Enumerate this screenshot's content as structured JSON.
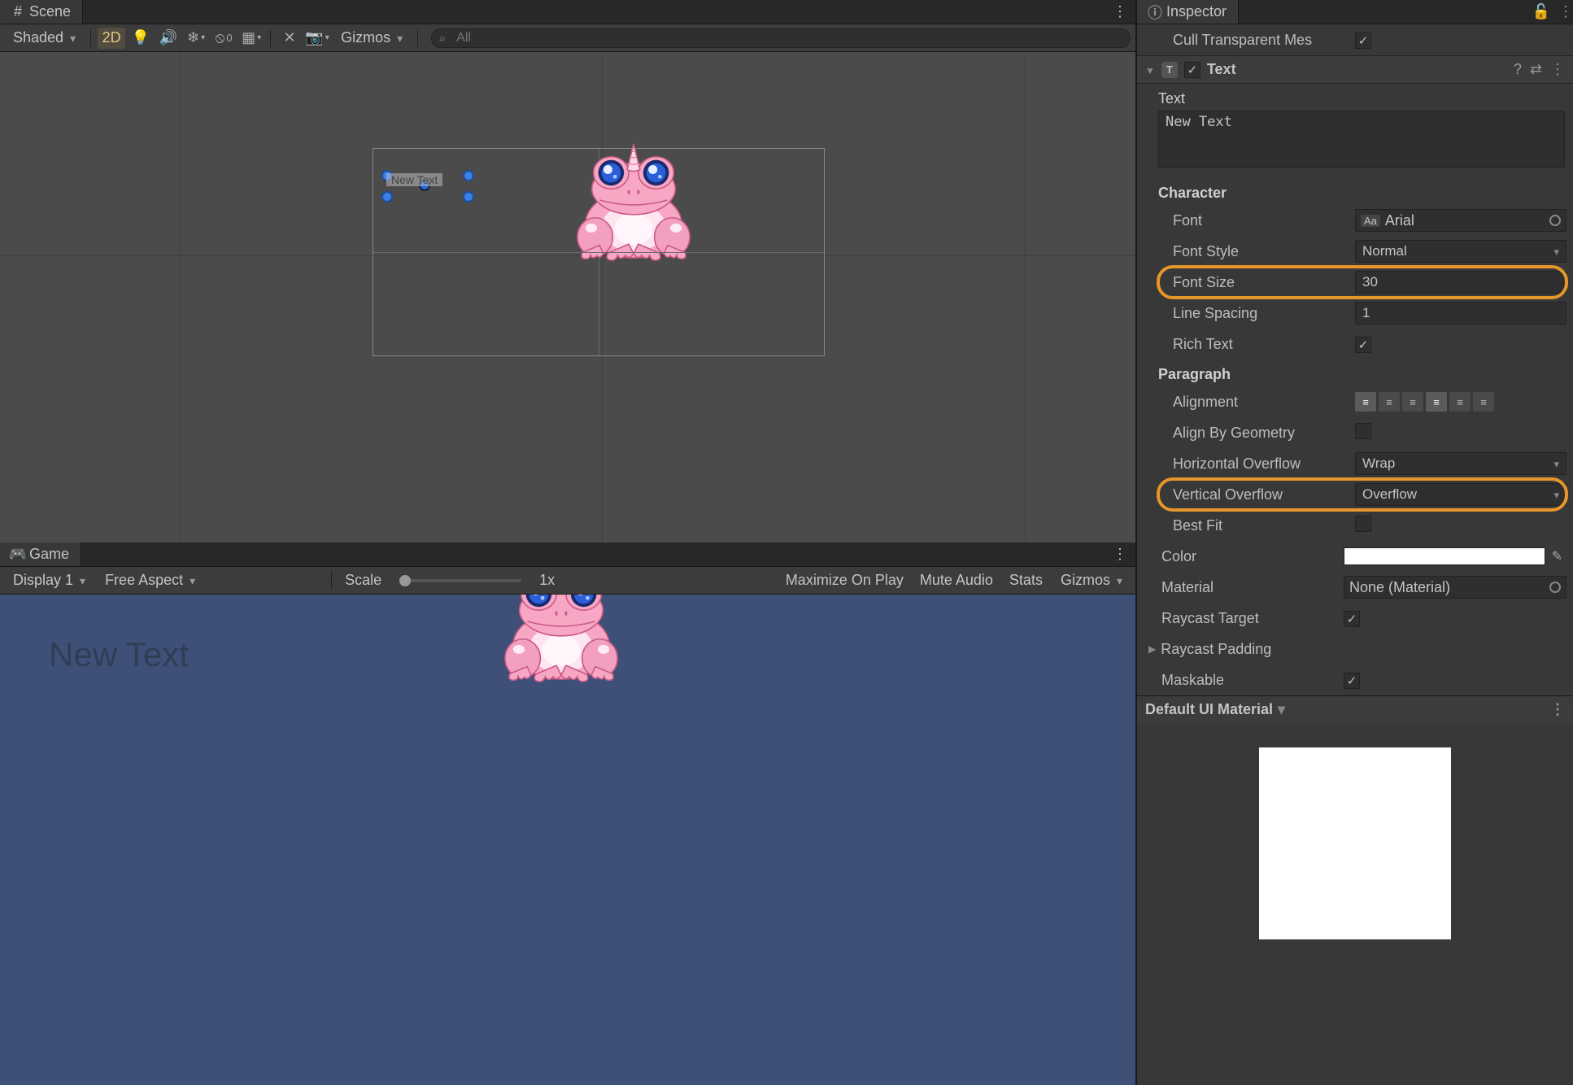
{
  "scene": {
    "tab_label": "Scene",
    "shading_mode": "Shaded",
    "btn_2d": "2D",
    "btn_text_badge": "0",
    "gizmos_label": "Gizmos",
    "search_placeholder": "All",
    "canvas_text": "New Text"
  },
  "game": {
    "tab_label": "Game",
    "display": "Display 1",
    "aspect": "Free Aspect",
    "scale_label": "Scale",
    "scale_value": "1x",
    "maximize": "Maximize On Play",
    "mute": "Mute Audio",
    "stats": "Stats",
    "gizmos": "Gizmos",
    "overlay_text": "New Text"
  },
  "inspector": {
    "title": "Inspector",
    "cull_label": "Cull Transparent Mes",
    "component": {
      "name": "Text",
      "text_label": "Text",
      "text_value": "New Text",
      "character_h": "Character",
      "font_label": "Font",
      "font_value": "Arial",
      "font_prefix": "Aa",
      "font_style_label": "Font Style",
      "font_style_value": "Normal",
      "font_size_label": "Font Size",
      "font_size_value": "30",
      "line_spacing_label": "Line Spacing",
      "line_spacing_value": "1",
      "rich_text_label": "Rich Text",
      "paragraph_h": "Paragraph",
      "alignment_label": "Alignment",
      "align_geometry_label": "Align By Geometry",
      "h_overflow_label": "Horizontal Overflow",
      "h_overflow_value": "Wrap",
      "v_overflow_label": "Vertical Overflow",
      "v_overflow_value": "Overflow",
      "best_fit_label": "Best Fit",
      "color_label": "Color",
      "material_label": "Material",
      "material_value": "None (Material)",
      "raycast_target_label": "Raycast Target",
      "raycast_padding_label": "Raycast Padding",
      "maskable_label": "Maskable"
    },
    "material_section": "Default UI Material"
  }
}
